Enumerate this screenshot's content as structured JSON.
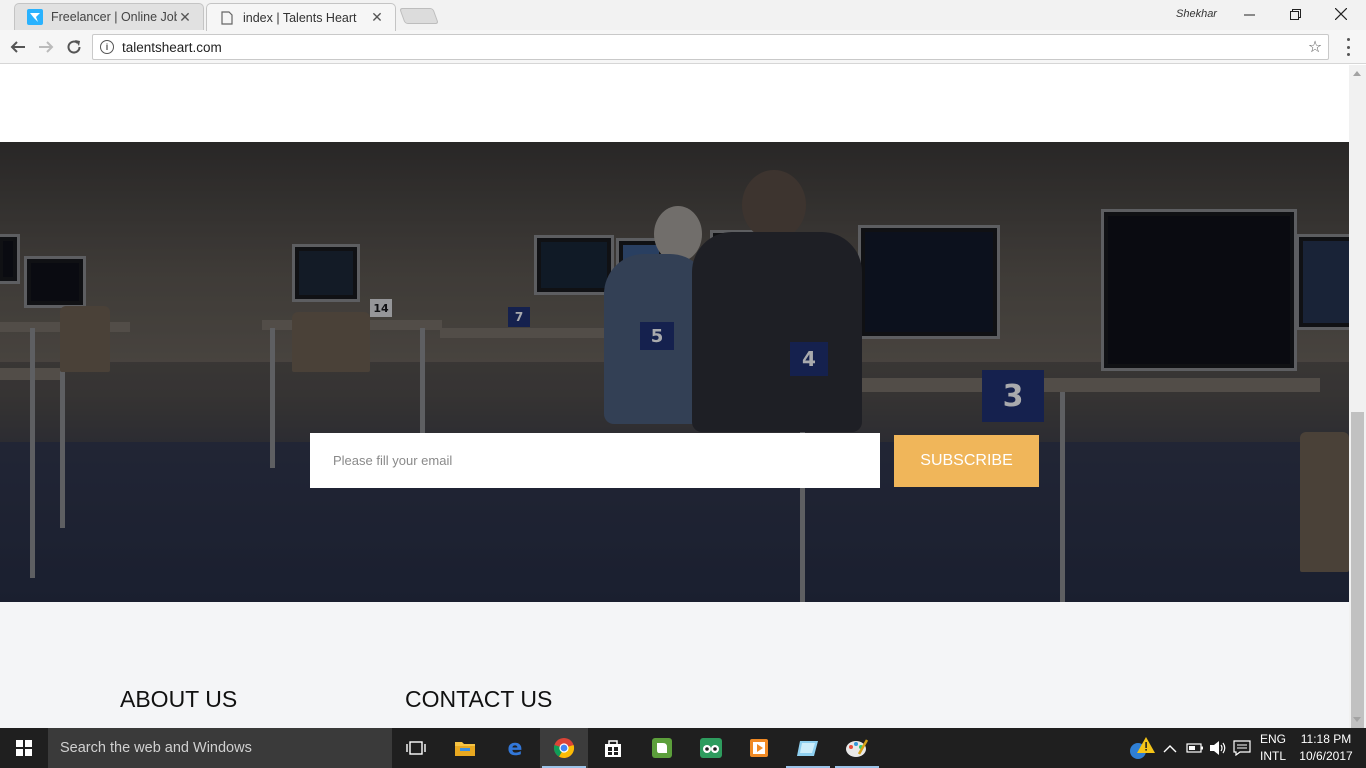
{
  "browser": {
    "tabs": [
      {
        "title": "Freelancer | Online Jobs |",
        "active": false
      },
      {
        "title": "index | Talents Heart",
        "active": true
      }
    ],
    "user_name": "Shekhar",
    "url": "talentsheart.com"
  },
  "page": {
    "subscribe": {
      "placeholder": "Please fill your email",
      "button_label": "SUBSCRIBE",
      "button_color": "#f0b65a"
    },
    "footer": {
      "about_title": "ABOUT US",
      "contact_title": "CONTACT US"
    },
    "classroom_numbers": [
      "5",
      "4",
      "3",
      "14",
      "7"
    ]
  },
  "taskbar": {
    "search_placeholder": "Search the web and Windows",
    "apps": [
      "task-view-icon",
      "file-explorer-icon",
      "edge-icon",
      "chrome-icon",
      "store-icon",
      "evernote-icon",
      "tripadvisor-icon",
      "media-player-icon",
      "app-icon",
      "paint-icon"
    ],
    "language": [
      "ENG",
      "INTL"
    ],
    "time": "11:18 PM",
    "date": "10/6/2017"
  }
}
